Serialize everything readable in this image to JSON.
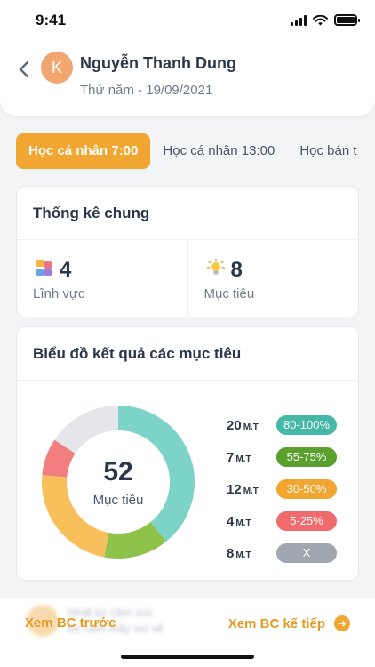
{
  "status": {
    "time": "9:41"
  },
  "header": {
    "avatar_letter": "K",
    "name": "Nguyễn Thanh Dung",
    "date": "Thứ năm - 19/09/2021",
    "avatar_color": "#f2a66f"
  },
  "tabs": [
    {
      "label": "Học cá nhân 7:00",
      "active": true
    },
    {
      "label": "Học cá nhân 13:00",
      "active": false
    },
    {
      "label": "Học bán t",
      "active": false
    }
  ],
  "summary": {
    "title": "Thống kê chung",
    "fields": {
      "value": "4",
      "label": "Lĩnh vực",
      "icon": "blocks-icon"
    },
    "goals": {
      "value": "8",
      "label": "Mục tiêu",
      "icon": "lightbulb-icon"
    }
  },
  "results": {
    "title": "Biểu đồ kết quả các mục tiêu",
    "total": "52",
    "total_label": "Mục tiêu",
    "unit": "M.T",
    "legend": [
      {
        "count": "20",
        "range": "80-100%",
        "color": "#46b8a8"
      },
      {
        "count": "7",
        "range": "55-75%",
        "color": "#5aa02c"
      },
      {
        "count": "12",
        "range": "30-50%",
        "color": "#f0a630"
      },
      {
        "count": "4",
        "range": "5-25%",
        "color": "#f06b6b"
      },
      {
        "count": "8",
        "range": "X",
        "color": "#a1a7b1"
      }
    ]
  },
  "chart_data": {
    "type": "pie",
    "categories": [
      "80-100%",
      "55-75%",
      "30-50%",
      "5-25%",
      "X"
    ],
    "values": [
      20,
      7,
      12,
      4,
      8
    ],
    "colors": [
      "#7ed3c8",
      "#8fc24a",
      "#f8c05a",
      "#f27f7f",
      "#e4e6ea"
    ]
  },
  "footer": {
    "prev_label": "Xem BC trước",
    "next_label": "Xem BC kế tiếp",
    "blurred_title": "Nhật ký cảm xúc",
    "blurred_sub": "bé cảm thấy vui vẻ"
  }
}
